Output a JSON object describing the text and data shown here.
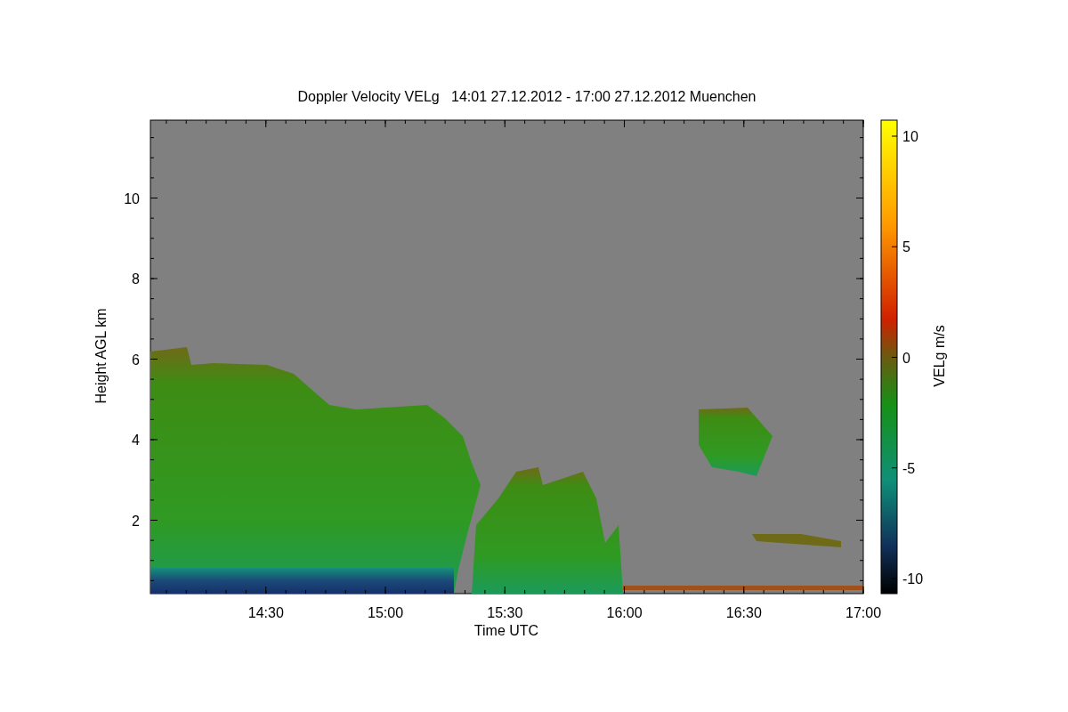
{
  "title": "Doppler Velocity VELg   14:01 27.12.2012 - 17:00 27.12.2012 Muenchen",
  "x_axis": {
    "label": "Time UTC",
    "ticks": [
      "14:30",
      "15:00",
      "15:30",
      "16:00",
      "16:30",
      "17:00"
    ]
  },
  "y_axis": {
    "label": "Height AGL km",
    "ticks": [
      "10",
      "8",
      "6",
      "4",
      "2"
    ]
  },
  "colorbar": {
    "label": "VELg m/s",
    "ticks": [
      "10",
      "5",
      "0",
      "-5",
      "-10"
    ]
  }
}
